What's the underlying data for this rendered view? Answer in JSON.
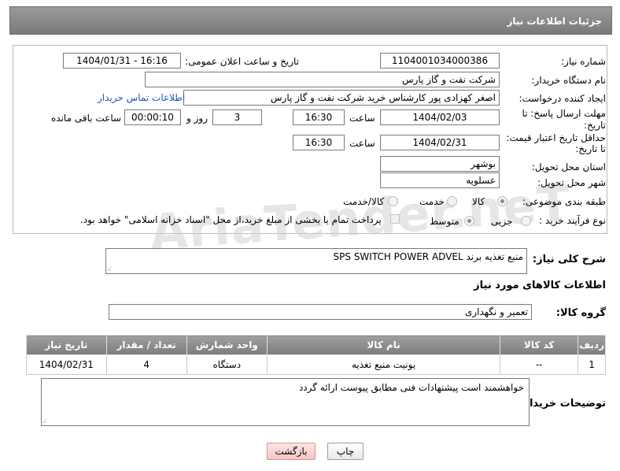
{
  "header": {
    "title": "جزئیات اطلاعات نیاز"
  },
  "fields": {
    "need_number": {
      "label": "شماره نیاز:",
      "value": "1104001034000386"
    },
    "announce_datetime": {
      "label": "تاریخ و ساعت اعلان عمومی:",
      "value": "1404/01/31 - 16:16"
    },
    "buyer_device": {
      "label": "نام دستگاه خریدار:",
      "value": "شرکت نفت و گاز پارس"
    },
    "requester": {
      "label": "ایجاد کننده درخواست:",
      "value": "اصغر کهزادی پور کارشناس خرید شرکت نفت و گاز پارس",
      "contact_link": "اطلاعات تماس خریدار"
    },
    "response_deadline": {
      "label_line1": "مهلت ارسال پاسخ: تا",
      "label_line2": "تاریخ:",
      "date": "1404/02/03",
      "time_label": "ساعت",
      "time": "16:30",
      "days": "3",
      "days_label": "روز و",
      "remaining": "00:00:10",
      "remaining_label": "ساعت باقی مانده"
    },
    "price_validity": {
      "label_line1": "حداقل تاریخ اعتبار قیمت:",
      "label_line2": "تا تاریخ:",
      "date": "1404/02/31",
      "time_label": "ساعت",
      "time": "16:30"
    },
    "delivery_province": {
      "label": "استان محل تحویل:",
      "value": "بوشهر"
    },
    "delivery_city": {
      "label": "شهر محل تحویل:",
      "value": "عسلویه"
    },
    "category": {
      "label": "طبقه بندی موضوعی:",
      "options": [
        "کالا",
        "خدمت",
        "کالا/خدمت"
      ],
      "selected": "کالا"
    },
    "purchase_type": {
      "label": "نوع فرآیند خرید :",
      "options": [
        "جزیی",
        "متوسط"
      ],
      "selected": "متوسط",
      "payment_note": "پرداخت تمام یا بخشی از مبلغ خرید،از محل \"اسناد خزانه اسلامی\" خواهد بود."
    }
  },
  "general_description": {
    "label": "شرح کلی نیاز:",
    "value": "منبع تغذیه برند SPS SWITCH POWER ADVEL"
  },
  "goods_section": {
    "title": "اطلاعات کالاهای مورد نیاز"
  },
  "goods_group": {
    "label": "گروه کالا:",
    "value": "تعمیر و نگهداری"
  },
  "items_table": {
    "headers": [
      "ردیف",
      "کد کالا",
      "نام کالا",
      "واحد شمارش",
      "تعداد / مقدار",
      "تاریخ نیاز"
    ],
    "rows": [
      [
        "1",
        "--",
        "یونیت منبع تغذیه",
        "دستگاه",
        "4",
        "1404/02/31"
      ]
    ]
  },
  "buyer_notes": {
    "label": "توضیحات خریدار:",
    "value": "خواهشمند است پیشنهادات فنی مطابق پیوست ارائه گردد"
  },
  "buttons": {
    "print": "چاپ",
    "back": "بازگشت"
  },
  "watermark": "AriaTender.neT"
}
